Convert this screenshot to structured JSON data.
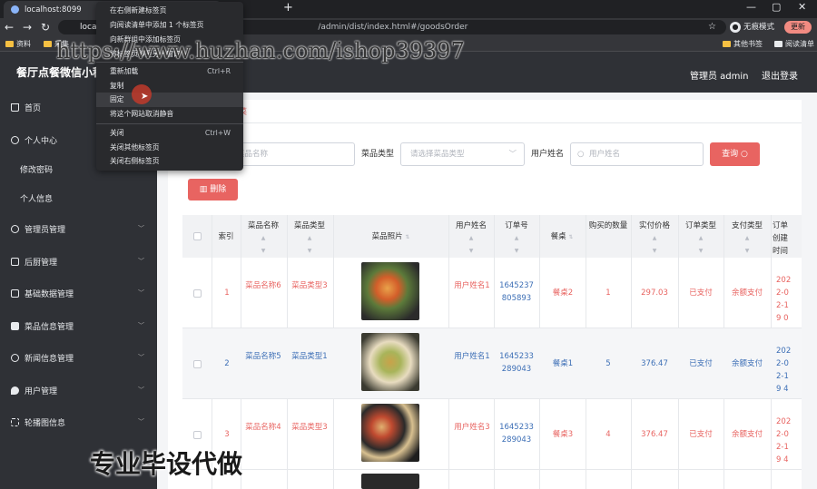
{
  "browser": {
    "tab_title": "localhost:8099",
    "tab_close": "×",
    "new_tab": "+",
    "address_host": "localhost:8099",
    "address_path": "/admin/dist/index.html#/goodsOrder",
    "profile_label": "无痕模式",
    "update_label": "更新",
    "bookmarks": [
      "资料",
      "采集",
      "其他书签",
      "阅读清单"
    ]
  },
  "context_menu": {
    "items": [
      {
        "label": "在右侧新建标签页",
        "shortcut": ""
      },
      {
        "label": "向阅读清单中添加 1 个标签页",
        "shortcut": ""
      },
      {
        "label": "向新群组中添加标签页",
        "shortcut": ""
      },
      {
        "label": "将标签页移至另一窗口",
        "shortcut": ""
      },
      {
        "label": "重新加载",
        "shortcut": "Ctrl+R"
      },
      {
        "label": "复制",
        "shortcut": ""
      },
      {
        "label": "固定",
        "shortcut": ""
      },
      {
        "label": "将这个网站取消静音",
        "shortcut": ""
      },
      {
        "label": "关闭",
        "shortcut": "Ctrl+W"
      },
      {
        "label": "关闭其他标签页",
        "shortcut": ""
      },
      {
        "label": "关闭右侧标签页",
        "shortcut": ""
      }
    ]
  },
  "header": {
    "app_title": "餐厅点餐微信小程序",
    "admin_label": "管理员 admin",
    "logout_label": "退出登录"
  },
  "sidebar": {
    "items": [
      {
        "label": "首页"
      },
      {
        "label": "个人中心"
      },
      {
        "label": "修改密码"
      },
      {
        "label": "个人信息"
      },
      {
        "label": "管理员管理"
      },
      {
        "label": "后厨管理"
      },
      {
        "label": "基础数据管理"
      },
      {
        "label": "菜品信息管理"
      },
      {
        "label": "新闻信息管理"
      },
      {
        "label": "用户管理"
      },
      {
        "label": "轮播图信息"
      }
    ]
  },
  "breadcrumb": {
    "current": "菜"
  },
  "search": {
    "dish_name_placeholder": "菜品名称",
    "dish_type_label": "菜品类型",
    "dish_type_placeholder": "请选择菜品类型",
    "user_name_label": "用户姓名",
    "user_name_placeholder": "用户姓名",
    "query_label": "查询"
  },
  "actions": {
    "delete_label": "删除"
  },
  "table": {
    "headers": [
      "索引",
      "菜品名称",
      "菜品类型",
      "菜品照片",
      "用户姓名",
      "订单号",
      "餐桌",
      "购买的数量",
      "实付价格",
      "订单类型",
      "支付类型",
      "订单创建时间"
    ],
    "rows": [
      {
        "index": "1",
        "dish_name": "菜品名称6",
        "dish_type": "菜品类型3",
        "user_name": "用户姓名1",
        "order_no": "1645237805893",
        "table_no": "餐桌2",
        "quantity": "1",
        "price": "297.03",
        "order_type": "已支付",
        "pay_type": "余额支付",
        "created": "2022-02-19 0",
        "color": "red"
      },
      {
        "index": "2",
        "dish_name": "菜品名称5",
        "dish_type": "菜品类型1",
        "user_name": "用户姓名1",
        "order_no": "1645233289043",
        "table_no": "餐桌1",
        "quantity": "5",
        "price": "376.47",
        "order_type": "已支付",
        "pay_type": "余额支付",
        "created": "2022-02-19 4",
        "color": "blue"
      },
      {
        "index": "3",
        "dish_name": "菜品名称4",
        "dish_type": "菜品类型3",
        "user_name": "用户姓名3",
        "order_no": "1645233289043",
        "table_no": "餐桌3",
        "quantity": "4",
        "price": "376.47",
        "order_type": "已支付",
        "pay_type": "余额支付",
        "created": "2022-02-19 4",
        "color": "red"
      }
    ]
  },
  "watermarks": {
    "url": "https://www.huzhan.com/ishop39397",
    "banner": "专业毕设代做"
  }
}
